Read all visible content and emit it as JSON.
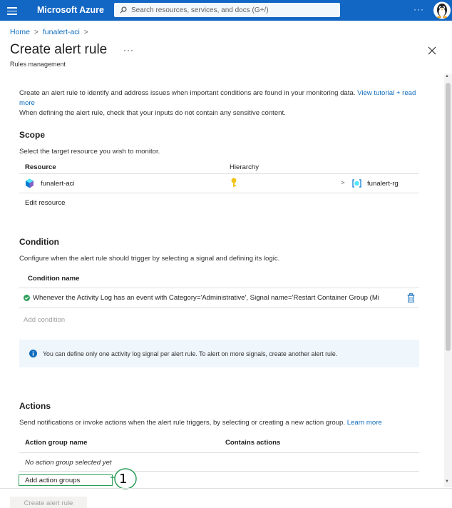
{
  "topbar": {
    "brand": "Microsoft Azure",
    "search_placeholder": "Search resources, services, and docs (G+/)",
    "more": "···"
  },
  "breadcrumb": {
    "home": "Home",
    "resource": "funalert-aci",
    "sep1": ">",
    "sep2": ">"
  },
  "header": {
    "title": "Create alert rule",
    "more": "···",
    "subtitle": "Rules management"
  },
  "intro": {
    "line1": "Create an alert rule to identify and address issues when important conditions are found in your monitoring data.",
    "link": "View tutorial + read more",
    "line2": "When defining the alert rule, check that your inputs do not contain any sensitive content."
  },
  "scope": {
    "title": "Scope",
    "desc": "Select the target resource you wish to monitor.",
    "col_resource": "Resource",
    "col_hierarchy": "Hierarchy",
    "resource_name": "funalert-aci",
    "hierarchy_chevron": ">",
    "hierarchy_rg": "funalert-rg",
    "edit_link": "Edit resource"
  },
  "condition": {
    "title": "Condition",
    "desc": "Configure when the alert rule should trigger by selecting a signal and defining its logic.",
    "col_name": "Condition name",
    "condition_text": "Whenever the Activity Log has an event with Category='Administrative', Signal name='Restart Container Group (Mi",
    "add_condition": "Add condition",
    "info": "You can define only one activity log signal per alert rule. To alert on more signals, create another alert rule."
  },
  "actions": {
    "title": "Actions",
    "desc": "Send notifications or invoke actions when the alert rule triggers, by selecting or creating a new action group.",
    "learn_more": "Learn more",
    "col_group": "Action group name",
    "col_contains": "Contains actions",
    "empty": "No action group selected yet",
    "add_link": "Add action groups"
  },
  "footer": {
    "create_button": "Create alert rule"
  },
  "callout": {
    "number": "1"
  },
  "colors": {
    "topbar": "#1266c4",
    "link": "#0f6cbd",
    "success": "#2e9e5a",
    "info_bg": "#eff6fc"
  }
}
